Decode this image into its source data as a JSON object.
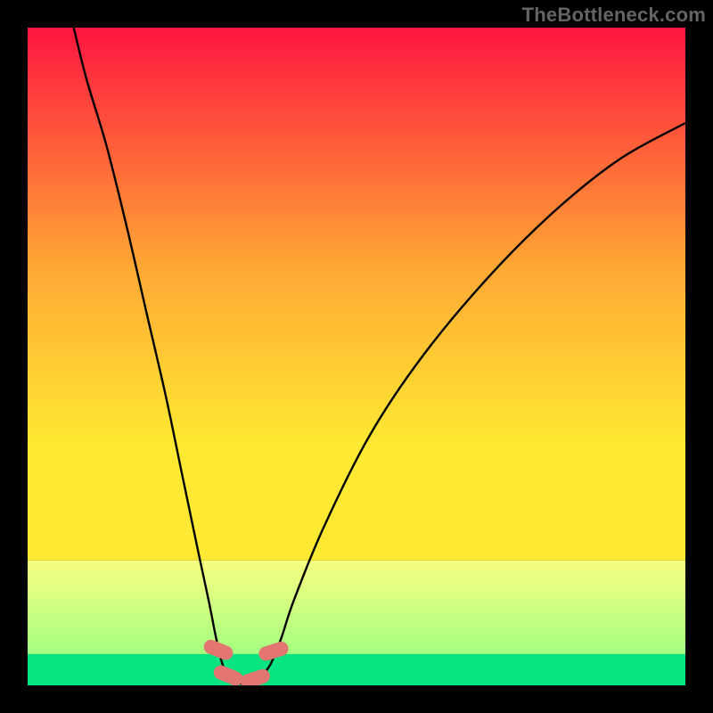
{
  "attribution": "TheBottleneck.com",
  "colors": {
    "top": "#fe163f",
    "mid1": "#ffa834",
    "mid2": "#ffe932",
    "band_top": "#f8ff80",
    "band_bottom": "#a4ff80",
    "bottom": "#05e682",
    "curve": "#000000",
    "marker": "#e37670"
  },
  "chart_data": {
    "type": "line",
    "title": "",
    "xlabel": "",
    "ylabel": "",
    "xlim": [
      0,
      100
    ],
    "ylim": [
      0,
      100
    ],
    "left_branch": [
      {
        "x": 7,
        "y": 100
      },
      {
        "x": 9,
        "y": 92
      },
      {
        "x": 12,
        "y": 82
      },
      {
        "x": 15,
        "y": 70
      },
      {
        "x": 18,
        "y": 57
      },
      {
        "x": 21,
        "y": 44
      },
      {
        "x": 23.5,
        "y": 32
      },
      {
        "x": 26,
        "y": 20
      },
      {
        "x": 27.5,
        "y": 13
      },
      {
        "x": 28.7,
        "y": 7
      },
      {
        "x": 29.7,
        "y": 3
      },
      {
        "x": 31,
        "y": 1
      },
      {
        "x": 33,
        "y": 0
      }
    ],
    "right_branch": [
      {
        "x": 33,
        "y": 0
      },
      {
        "x": 35,
        "y": 1
      },
      {
        "x": 36.8,
        "y": 3
      },
      {
        "x": 38.5,
        "y": 7
      },
      {
        "x": 40.5,
        "y": 13
      },
      {
        "x": 45,
        "y": 24
      },
      {
        "x": 52,
        "y": 38
      },
      {
        "x": 60,
        "y": 50
      },
      {
        "x": 70,
        "y": 62
      },
      {
        "x": 80,
        "y": 72
      },
      {
        "x": 90,
        "y": 80
      },
      {
        "x": 100,
        "y": 85.5
      }
    ],
    "markers": [
      {
        "x": 29.0,
        "y": 5.4
      },
      {
        "x": 30.5,
        "y": 1.5
      },
      {
        "x": 34.6,
        "y": 1.0
      },
      {
        "x": 37.4,
        "y": 5.2
      }
    ],
    "good_band": {
      "y_start": 0,
      "y_end": 19
    }
  }
}
